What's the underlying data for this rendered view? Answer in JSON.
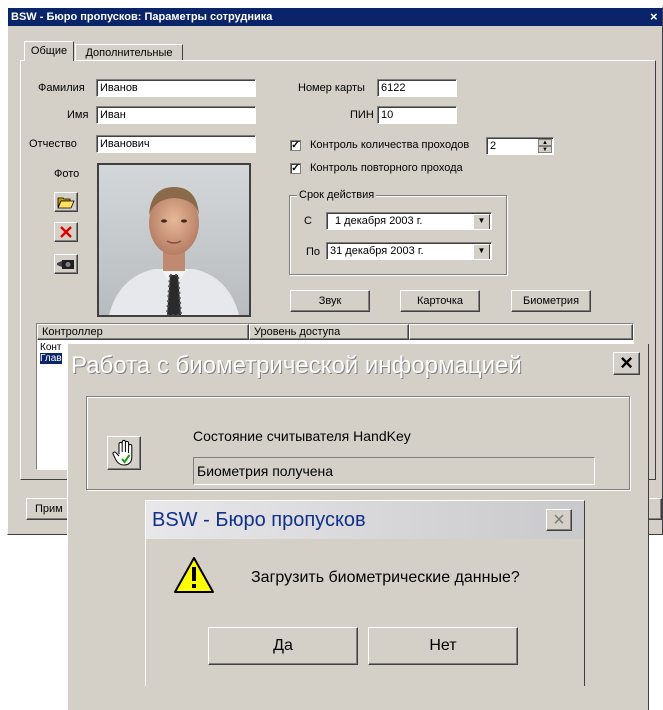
{
  "main_window": {
    "title": "BSW - Бюро пропусков: Параметры сотрудника",
    "close_glyph": "×",
    "tabs": [
      "Общие",
      "Дополнительные"
    ],
    "fields": {
      "lastname_label": "Фамилия",
      "lastname": "Иванов",
      "firstname_label": "Имя",
      "firstname": "Иван",
      "patronymic_label": "Отчество",
      "patronymic": "Иванович",
      "photo_label": "Фото",
      "card_label": "Номер карты",
      "card": "6122",
      "pin_label": "ПИН",
      "pin": "10"
    },
    "checks": {
      "pass_count_label": "Контроль количества проходов",
      "pass_count_checked": true,
      "pass_count_value": "2",
      "repeat_pass_label": "Контроль повторного прохода",
      "repeat_pass_checked": true
    },
    "validity": {
      "group_label": "Срок действия",
      "from_label": "С",
      "from": "1 декабря 2003 г.",
      "to_label": "По",
      "to": "31 декабря 2003 г."
    },
    "buttons": {
      "sound": "Звук",
      "card": "Карточка",
      "biometry": "Биометрия",
      "apply_partial": "Прим"
    },
    "table": {
      "columns": [
        "Контроллер",
        "Уровень доступа"
      ],
      "rows_partial": [
        "Конт",
        "Глав"
      ]
    }
  },
  "bio_dialog": {
    "title": "Работа с  биометрической информацией",
    "close_glyph": "×",
    "reader_state_label": "Состояние считывателя HandKey",
    "status": "Биометрия получена"
  },
  "confirm_dialog": {
    "title": "BSW - Бюро пропусков",
    "close_glyph": "×",
    "message": "Загрузить биометрические данные?",
    "yes": "Да",
    "no": "Нет",
    "icon_glyph": "!"
  }
}
